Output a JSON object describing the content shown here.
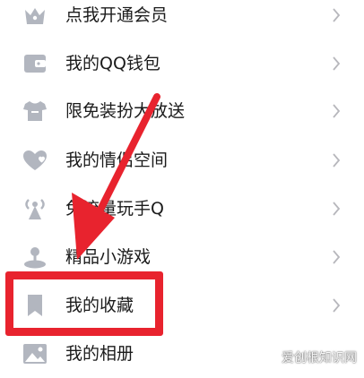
{
  "menu": {
    "items": [
      {
        "label": "点我开通会员",
        "icon": "vip-crown-icon"
      },
      {
        "label": "我的QQ钱包",
        "icon": "wallet-icon"
      },
      {
        "label": "限免装扮大放送",
        "icon": "tshirt-icon"
      },
      {
        "label": "我的情侣空间",
        "icon": "heart-icon"
      },
      {
        "label": "免流量玩手Q",
        "icon": "signal-tower-icon"
      },
      {
        "label": "精品小游戏",
        "icon": "joystick-icon"
      },
      {
        "label": "我的收藏",
        "icon": "bookmark-icon"
      },
      {
        "label": "我的相册",
        "icon": "photo-icon"
      }
    ]
  },
  "annotation": {
    "arrow_color": "#e8232e",
    "box_color": "#e8232e"
  },
  "watermark": {
    "text": "爱创根知识网"
  },
  "colors": {
    "icon": "#b2b6bf",
    "text": "#1b1b1b",
    "chevron": "#b7b7bc"
  }
}
